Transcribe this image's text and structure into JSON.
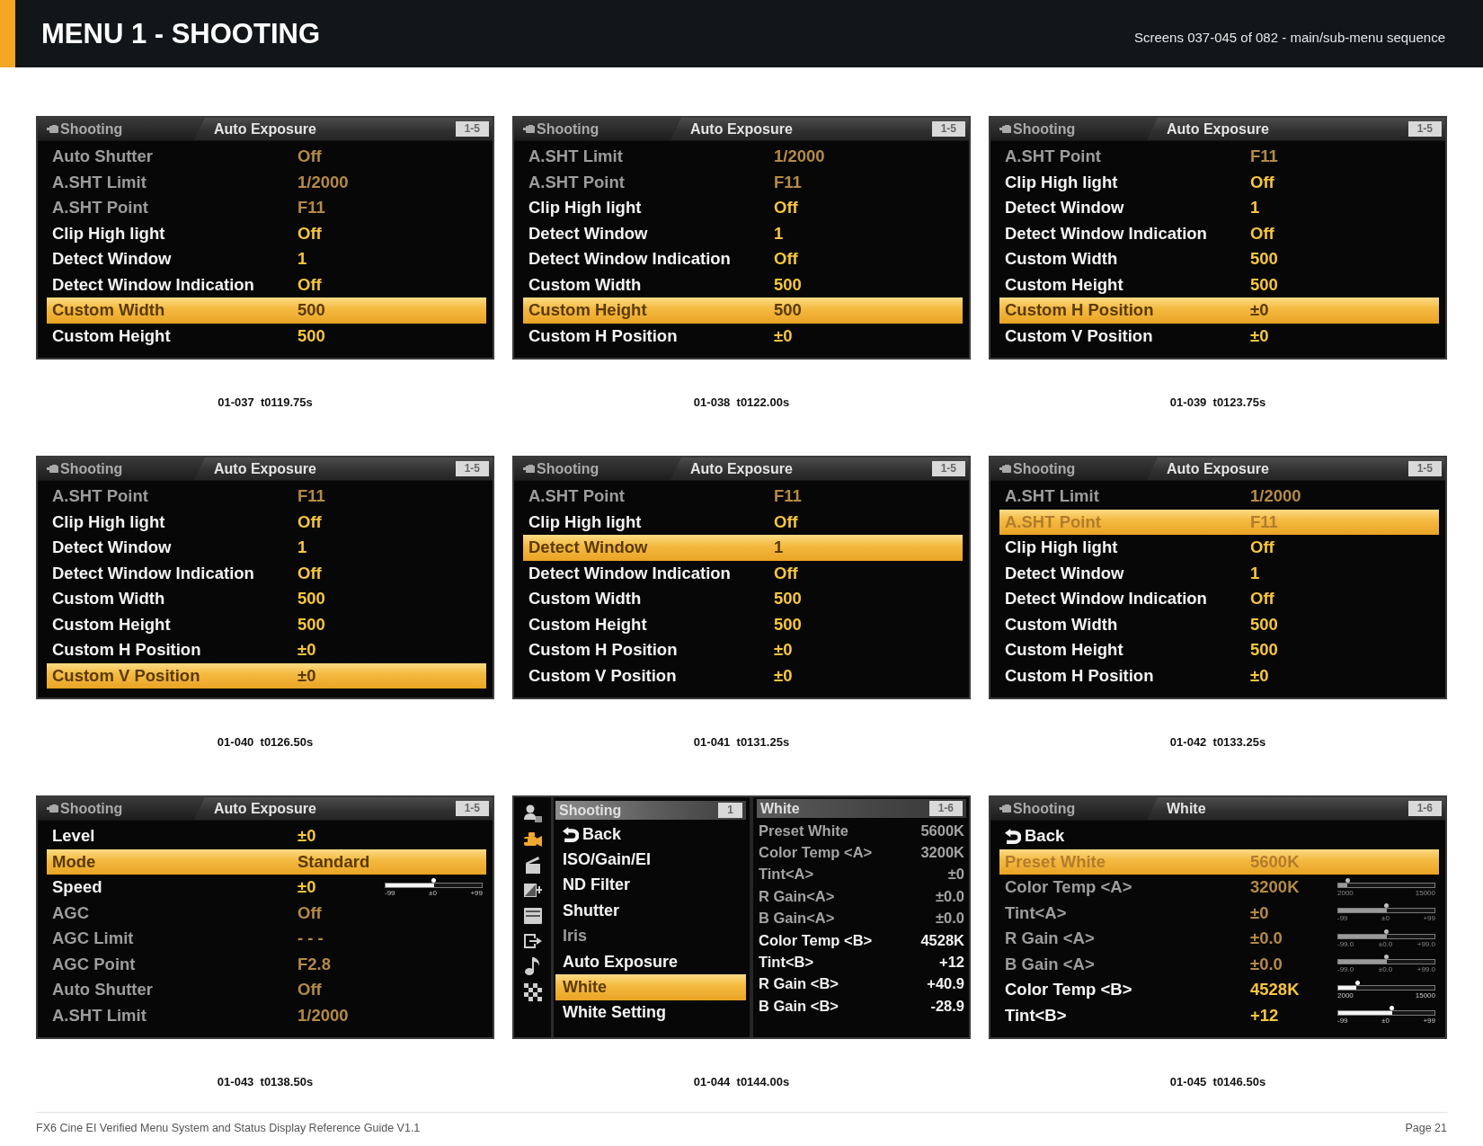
{
  "header": {
    "title": "MENU 1 - SHOOTING",
    "subtitle": "Screens 037-045 of 082 - main/sub-menu sequence"
  },
  "screens": [
    {
      "kind": "list",
      "caption": "01-037  t0119.75s",
      "menu": "Shooting",
      "submenu": "Auto Exposure",
      "page": "1-5",
      "rows": [
        {
          "kind": "setting",
          "label": "Auto Shutter",
          "value": "Off",
          "disabled": true,
          "selected": false
        },
        {
          "kind": "setting",
          "label": "A.SHT Limit",
          "value": "1/2000",
          "disabled": true,
          "selected": false
        },
        {
          "kind": "setting",
          "label": "A.SHT Point",
          "value": "F11",
          "disabled": true,
          "selected": false
        },
        {
          "kind": "setting",
          "label": "Clip High light",
          "value": "Off",
          "disabled": false,
          "selected": false
        },
        {
          "kind": "setting",
          "label": "Detect Window",
          "value": "1",
          "disabled": false,
          "selected": false
        },
        {
          "kind": "setting",
          "label": "Detect Window Indication",
          "value": "Off",
          "disabled": false,
          "selected": false
        },
        {
          "kind": "setting",
          "label": "Custom Width",
          "value": "500",
          "disabled": false,
          "selected": true
        },
        {
          "kind": "setting",
          "label": "Custom Height",
          "value": "500",
          "disabled": false,
          "selected": false
        }
      ]
    },
    {
      "kind": "list",
      "caption": "01-038  t0122.00s",
      "menu": "Shooting",
      "submenu": "Auto Exposure",
      "page": "1-5",
      "rows": [
        {
          "kind": "setting",
          "label": "A.SHT Limit",
          "value": "1/2000",
          "disabled": true,
          "selected": false
        },
        {
          "kind": "setting",
          "label": "A.SHT Point",
          "value": "F11",
          "disabled": true,
          "selected": false
        },
        {
          "kind": "setting",
          "label": "Clip High light",
          "value": "Off",
          "disabled": false,
          "selected": false
        },
        {
          "kind": "setting",
          "label": "Detect Window",
          "value": "1",
          "disabled": false,
          "selected": false
        },
        {
          "kind": "setting",
          "label": "Detect Window Indication",
          "value": "Off",
          "disabled": false,
          "selected": false
        },
        {
          "kind": "setting",
          "label": "Custom Width",
          "value": "500",
          "disabled": false,
          "selected": false
        },
        {
          "kind": "setting",
          "label": "Custom Height",
          "value": "500",
          "disabled": false,
          "selected": true
        },
        {
          "kind": "setting",
          "label": "Custom H Position",
          "value": "±0",
          "disabled": false,
          "selected": false
        }
      ]
    },
    {
      "kind": "list",
      "caption": "01-039  t0123.75s",
      "menu": "Shooting",
      "submenu": "Auto Exposure",
      "page": "1-5",
      "rows": [
        {
          "kind": "setting",
          "label": "A.SHT Point",
          "value": "F11",
          "disabled": true,
          "selected": false
        },
        {
          "kind": "setting",
          "label": "Clip High light",
          "value": "Off",
          "disabled": false,
          "selected": false
        },
        {
          "kind": "setting",
          "label": "Detect Window",
          "value": "1",
          "disabled": false,
          "selected": false
        },
        {
          "kind": "setting",
          "label": "Detect Window Indication",
          "value": "Off",
          "disabled": false,
          "selected": false
        },
        {
          "kind": "setting",
          "label": "Custom Width",
          "value": "500",
          "disabled": false,
          "selected": false
        },
        {
          "kind": "setting",
          "label": "Custom Height",
          "value": "500",
          "disabled": false,
          "selected": false
        },
        {
          "kind": "setting",
          "label": "Custom H Position",
          "value": "±0",
          "disabled": false,
          "selected": true
        },
        {
          "kind": "setting",
          "label": "Custom V Position",
          "value": "±0",
          "disabled": false,
          "selected": false
        }
      ]
    },
    {
      "kind": "list",
      "caption": "01-040  t0126.50s",
      "menu": "Shooting",
      "submenu": "Auto Exposure",
      "page": "1-5",
      "rows": [
        {
          "kind": "setting",
          "label": "A.SHT Point",
          "value": "F11",
          "disabled": true,
          "selected": false
        },
        {
          "kind": "setting",
          "label": "Clip High light",
          "value": "Off",
          "disabled": false,
          "selected": false
        },
        {
          "kind": "setting",
          "label": "Detect Window",
          "value": "1",
          "disabled": false,
          "selected": false
        },
        {
          "kind": "setting",
          "label": "Detect Window Indication",
          "value": "Off",
          "disabled": false,
          "selected": false
        },
        {
          "kind": "setting",
          "label": "Custom Width",
          "value": "500",
          "disabled": false,
          "selected": false
        },
        {
          "kind": "setting",
          "label": "Custom Height",
          "value": "500",
          "disabled": false,
          "selected": false
        },
        {
          "kind": "setting",
          "label": "Custom H Position",
          "value": "±0",
          "disabled": false,
          "selected": false
        },
        {
          "kind": "setting",
          "label": "Custom V Position",
          "value": "±0",
          "disabled": false,
          "selected": true
        }
      ]
    },
    {
      "kind": "list",
      "caption": "01-041  t0131.25s",
      "menu": "Shooting",
      "submenu": "Auto Exposure",
      "page": "1-5",
      "rows": [
        {
          "kind": "setting",
          "label": "A.SHT Point",
          "value": "F11",
          "disabled": true,
          "selected": false
        },
        {
          "kind": "setting",
          "label": "Clip High light",
          "value": "Off",
          "disabled": false,
          "selected": false
        },
        {
          "kind": "setting",
          "label": "Detect Window",
          "value": "1",
          "disabled": false,
          "selected": true
        },
        {
          "kind": "setting",
          "label": "Detect Window Indication",
          "value": "Off",
          "disabled": false,
          "selected": false
        },
        {
          "kind": "setting",
          "label": "Custom Width",
          "value": "500",
          "disabled": false,
          "selected": false
        },
        {
          "kind": "setting",
          "label": "Custom Height",
          "value": "500",
          "disabled": false,
          "selected": false
        },
        {
          "kind": "setting",
          "label": "Custom H Position",
          "value": "±0",
          "disabled": false,
          "selected": false
        },
        {
          "kind": "setting",
          "label": "Custom V Position",
          "value": "±0",
          "disabled": false,
          "selected": false
        }
      ]
    },
    {
      "kind": "list",
      "caption": "01-042  t0133.25s",
      "menu": "Shooting",
      "submenu": "Auto Exposure",
      "page": "1-5",
      "rows": [
        {
          "kind": "setting",
          "label": "A.SHT Limit",
          "value": "1/2000",
          "disabled": true,
          "selected": false
        },
        {
          "kind": "setting",
          "label": "A.SHT Point",
          "value": "F11",
          "disabled": true,
          "selected": true
        },
        {
          "kind": "setting",
          "label": "Clip High light",
          "value": "Off",
          "disabled": false,
          "selected": false
        },
        {
          "kind": "setting",
          "label": "Detect Window",
          "value": "1",
          "disabled": false,
          "selected": false
        },
        {
          "kind": "setting",
          "label": "Detect Window Indication",
          "value": "Off",
          "disabled": false,
          "selected": false
        },
        {
          "kind": "setting",
          "label": "Custom Width",
          "value": "500",
          "disabled": false,
          "selected": false
        },
        {
          "kind": "setting",
          "label": "Custom Height",
          "value": "500",
          "disabled": false,
          "selected": false
        },
        {
          "kind": "setting",
          "label": "Custom H Position",
          "value": "±0",
          "disabled": false,
          "selected": false
        }
      ]
    },
    {
      "kind": "list",
      "caption": "01-043  t0138.50s",
      "menu": "Shooting",
      "submenu": "Auto Exposure",
      "page": "1-5",
      "rows": [
        {
          "kind": "setting",
          "label": "Level",
          "value": "±0",
          "disabled": false,
          "selected": false
        },
        {
          "kind": "setting",
          "label": "Mode",
          "value": "Standard",
          "disabled": false,
          "selected": true
        },
        {
          "kind": "slider",
          "label": "Speed",
          "value": "±0",
          "disabled": false,
          "selected": false,
          "level": 0.5,
          "ticks": [
            "-99",
            "±0",
            "+99"
          ]
        },
        {
          "kind": "setting",
          "label": "AGC",
          "value": "Off",
          "disabled": true,
          "selected": false
        },
        {
          "kind": "setting",
          "label": "AGC Limit",
          "value": "- - -",
          "disabled": true,
          "selected": false
        },
        {
          "kind": "setting",
          "label": "AGC Point",
          "value": "F2.8",
          "disabled": true,
          "selected": false
        },
        {
          "kind": "setting",
          "label": "Auto Shutter",
          "value": "Off",
          "disabled": true,
          "selected": false
        },
        {
          "kind": "setting",
          "label": "A.SHT Limit",
          "value": "1/2000",
          "disabled": true,
          "selected": false
        }
      ]
    },
    {
      "kind": "split",
      "caption": "01-044  t0144.00s",
      "icons": [
        {
          "kind": "user",
          "selected": false
        },
        {
          "kind": "camera",
          "selected": true
        },
        {
          "kind": "clapper",
          "selected": false
        },
        {
          "kind": "paint",
          "selected": false
        },
        {
          "kind": "media",
          "selected": false
        },
        {
          "kind": "output",
          "selected": false
        },
        {
          "kind": "audio",
          "selected": false
        },
        {
          "kind": "grid",
          "selected": false
        }
      ],
      "menu": {
        "title": "Shooting",
        "page": "1",
        "items": [
          {
            "kind": "back",
            "label": "Back",
            "disabled": false,
            "selected": false
          },
          {
            "kind": "setting",
            "label": "ISO/Gain/EI",
            "disabled": false,
            "selected": false
          },
          {
            "kind": "setting",
            "label": "ND Filter",
            "disabled": false,
            "selected": false
          },
          {
            "kind": "setting",
            "label": "Shutter",
            "disabled": false,
            "selected": false
          },
          {
            "kind": "setting",
            "label": "Iris",
            "disabled": true,
            "selected": false
          },
          {
            "kind": "setting",
            "label": "Auto Exposure",
            "disabled": false,
            "selected": false
          },
          {
            "kind": "setting",
            "label": "White",
            "disabled": false,
            "selected": true
          },
          {
            "kind": "setting",
            "label": "White Setting",
            "disabled": false,
            "selected": false
          }
        ]
      },
      "submenu": {
        "title": "White",
        "page": "1-6",
        "rows": [
          {
            "label": "Preset White",
            "value": "5600K",
            "disabled": true,
            "selected": false
          },
          {
            "label": "Color Temp <A>",
            "value": "3200K",
            "disabled": true,
            "selected": false
          },
          {
            "label": "Tint<A>",
            "value": "±0",
            "disabled": true,
            "selected": false
          },
          {
            "label": "R Gain<A>",
            "value": "±0.0",
            "disabled": true,
            "selected": false
          },
          {
            "label": "B Gain<A>",
            "value": "±0.0",
            "disabled": true,
            "selected": false
          },
          {
            "label": "Color Temp <B>",
            "value": "4528K",
            "disabled": false,
            "selected": false
          },
          {
            "label": "Tint<B>",
            "value": "+12",
            "disabled": false,
            "selected": false
          },
          {
            "label": "R Gain <B>",
            "value": "+40.9",
            "disabled": false,
            "selected": false
          },
          {
            "label": "B Gain <B>",
            "value": "-28.9",
            "disabled": false,
            "selected": false
          }
        ]
      }
    },
    {
      "kind": "list",
      "caption": "01-045  t0146.50s",
      "menu": "Shooting",
      "submenu": "White",
      "page": "1-6",
      "rows": [
        {
          "kind": "back",
          "label": "Back",
          "disabled": false,
          "selected": false
        },
        {
          "kind": "setting",
          "label": "Preset White",
          "value": "5600K",
          "disabled": true,
          "selected": true
        },
        {
          "kind": "slider",
          "label": "Color Temp <A>",
          "value": "3200K",
          "disabled": true,
          "selected": false,
          "level": 0.09,
          "ticks": [
            "2000",
            "15000"
          ]
        },
        {
          "kind": "slider",
          "label": "Tint<A>",
          "value": "±0",
          "disabled": true,
          "selected": false,
          "level": 0.5,
          "ticks": [
            "-99",
            "±0",
            "+99"
          ]
        },
        {
          "kind": "slider",
          "label": "R Gain <A>",
          "value": "±0.0",
          "disabled": true,
          "selected": false,
          "level": 0.5,
          "ticks": [
            "-99.0",
            "±0.0",
            "+99.0"
          ]
        },
        {
          "kind": "slider",
          "label": "B Gain <A>",
          "value": "±0.0",
          "disabled": true,
          "selected": false,
          "level": 0.5,
          "ticks": [
            "-99.0",
            "±0.0",
            "+99.0"
          ]
        },
        {
          "kind": "slider",
          "label": "Color Temp <B>",
          "value": "4528K",
          "disabled": false,
          "selected": false,
          "level": 0.19,
          "ticks": [
            "2000",
            "15000"
          ]
        },
        {
          "kind": "slider",
          "label": "Tint<B>",
          "value": "+12",
          "disabled": false,
          "selected": false,
          "level": 0.56,
          "ticks": [
            "-99",
            "±0",
            "+99"
          ]
        }
      ]
    }
  ],
  "footer": {
    "text": "FX6 Cine EI Verified Menu System and Status Display Reference Guide V1.1",
    "page": "Page 21"
  }
}
